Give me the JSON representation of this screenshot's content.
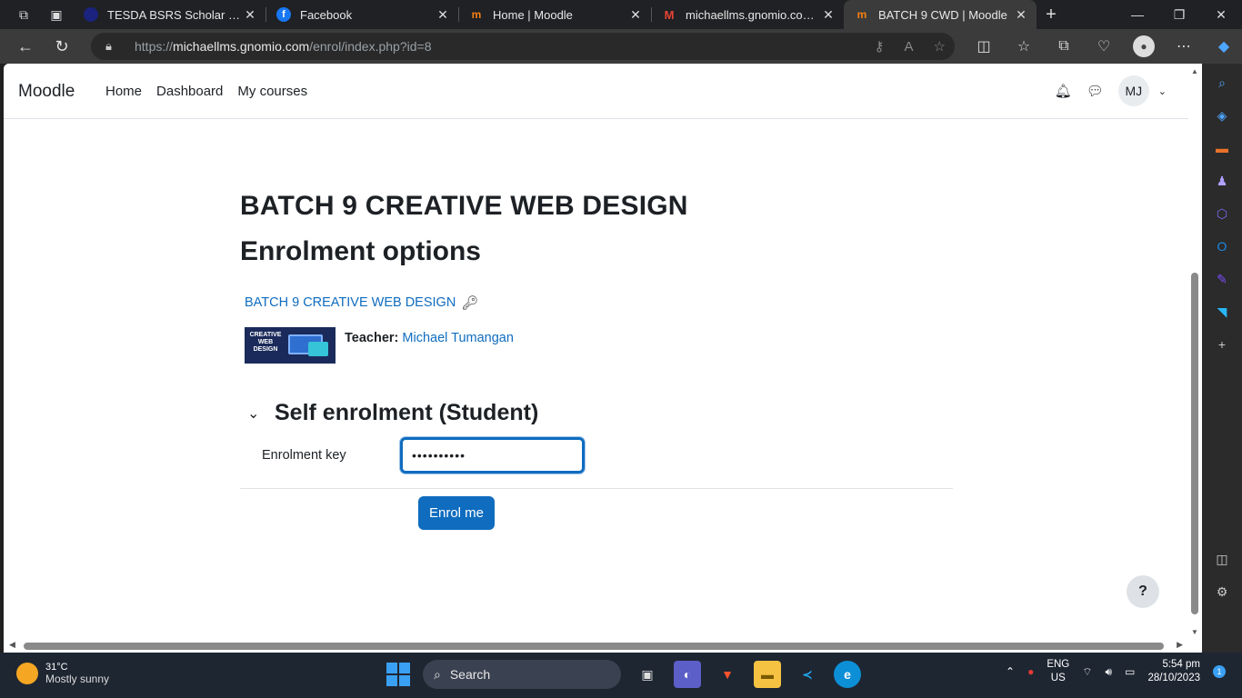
{
  "browser": {
    "tabs": [
      {
        "title": "TESDA BSRS Scholar Profile",
        "favicon_color": "#1a237e",
        "active": false
      },
      {
        "title": "Facebook",
        "favicon_color": "#1877f2",
        "active": false
      },
      {
        "title": "Home | Moodle",
        "favicon_color": "#f98012",
        "active": false
      },
      {
        "title": "michaellms.gnomio.com: Pa",
        "favicon_color": "#ea4335",
        "active": false
      },
      {
        "title": "BATCH 9 CWD | Moodle",
        "favicon_color": "#f98012",
        "active": true
      }
    ],
    "url_prefix": "https://",
    "url_host": "michaellms.gnomio.com",
    "url_path": "/enrol/index.php?id=8"
  },
  "moodle": {
    "brand": "Moodle",
    "nav": [
      "Home",
      "Dashboard",
      "My courses"
    ],
    "user_initials": "MJ"
  },
  "page": {
    "course_title": "BATCH 9 CREATIVE WEB DESIGN",
    "heading": "Enrolment options",
    "course_link": "BATCH 9 CREATIVE WEB DESIGN",
    "course_image_text": "CREATIVE WEB DESIGN",
    "teacher_label": "Teacher:",
    "teacher_name": "Michael Tumangan",
    "section_title": "Self enrolment (Student)",
    "enrolment_key_label": "Enrolment key",
    "enrolment_key_value": "••••••••••",
    "enrol_button": "Enrol me",
    "help_label": "?"
  },
  "taskbar": {
    "temperature": "31°C",
    "weather": "Mostly sunny",
    "search_label": "Search",
    "lang_1": "ENG",
    "lang_2": "US",
    "time": "5:54 pm",
    "date": "28/10/2023",
    "notification_count": "1"
  }
}
